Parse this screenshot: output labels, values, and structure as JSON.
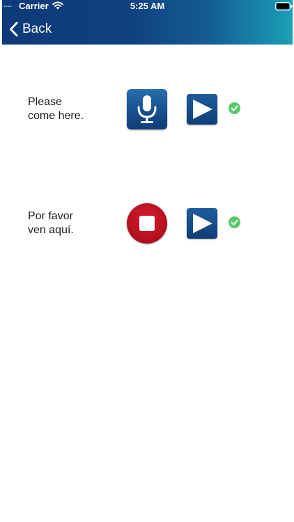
{
  "status_bar": {
    "signal": "....",
    "carrier": "Carrier",
    "time": "5:25 AM"
  },
  "nav": {
    "back_label": "Back"
  },
  "phrases": [
    {
      "line1": "Please",
      "line2": "come here.",
      "record_state": "microphone",
      "recorded": true
    },
    {
      "line1": "Por favor",
      "line2": "ven aquí.",
      "record_state": "stop",
      "recorded": true
    }
  ],
  "colors": {
    "header_start": "#0d3a7a",
    "header_end": "#1c9fb6",
    "button_blue": "#174f8f",
    "stop_red": "#b8101f",
    "check_green": "#58c96a"
  },
  "icons": {
    "back": "chevron-left-icon",
    "wifi": "wifi-icon",
    "battery": "battery-icon",
    "record": "microphone-icon",
    "stop": "stop-icon",
    "play": "play-icon",
    "check": "checkmark-icon"
  }
}
